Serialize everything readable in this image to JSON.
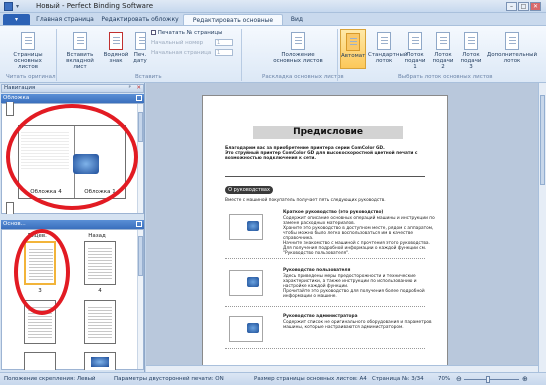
{
  "window": {
    "title": "Новый - Perfect Binding Software",
    "quick_access": "▾",
    "min": "–",
    "max": "□",
    "close": "✕"
  },
  "ribbon_tabs": {
    "file": "▾",
    "tabs": [
      "Главная страница",
      "Редактировать обложку",
      "Редактировать основные листы",
      "Вид"
    ],
    "active_index": 2
  },
  "ribbon": {
    "group_read": {
      "label": "Читать оригинал",
      "btn_pages": "Страницы основных листов"
    },
    "group_insert": {
      "label": "Вставить",
      "btn_insert": "Вставить вкладной лист",
      "btn_watermark": "Водяной знак",
      "btn_print_date": "Печ. дату",
      "chk_print_pages": "Печатать № страницы",
      "start_number_label": "Начальный номер",
      "start_number_value": "1",
      "start_page_label": "Начальная страница",
      "start_page_value": "1"
    },
    "group_layout": {
      "label": "Раскладка основных листов",
      "btn_position": "Положение основных листов"
    },
    "group_tray": {
      "label": "Выбрать лоток основных листов",
      "buttons": [
        "Автомат",
        "Стандартный лоток",
        "Лоток подачи 1",
        "Лоток подачи 2",
        "Лоток подачи 3",
        "Дополнительный лоток"
      ]
    }
  },
  "nav": {
    "title": "Навигация",
    "pin": "ᵖ",
    "close": "✕",
    "cover_section": "Обложка",
    "cover_labels": [
      "Обложка 4",
      "Обложка 1"
    ],
    "main_section": "Основ...",
    "main_labels": [
      "Лицев.",
      "Назад"
    ],
    "page_numbers": [
      "3",
      "4"
    ]
  },
  "document": {
    "heading": "Предисловие",
    "intro": "Благодарим вас за приобретение принтера серии ComColor GD.\nЭто струйный принтер ComColor GD для высокоскоростной цветной печати с возможностью подключения к сети.",
    "about_pill": "О руководствах",
    "about_text": "Вместе с машиной покупатель получает пять следующих руководств.",
    "sections": [
      {
        "title": "Краткое руководство (это руководство)",
        "body": "Содержит описание основных операций машины и инструкции по замене расходных материалов.\nХраните это руководство в доступном месте, рядом с аппаратом, чтобы можно было легко воспользоваться им в качестве справочника.\nНачните знакомство с машиной с прочтения этого руководства.\nДля получения подробной информации о каждой функции см. \"Руководство пользователя\"."
      },
      {
        "title": "Руководство пользователя",
        "body": "Здесь приведены меры предосторожности и технические характеристики, а также инструкции по использованию и настройке каждой функции.\nПрочитайте это руководство для получения более подробной информации о машине."
      },
      {
        "title": "Руководство администратора",
        "body": "Содержит список не оригинального оборудования и параметров машины, которые настраиваются администратором."
      }
    ]
  },
  "status": {
    "binding": "Положение скрепления: Левый",
    "duplex": "Параметры двусторонней печати: ON",
    "size": "Размер страницы основных листов: A4",
    "page": "Страница №: 3/34",
    "zoom": "70%",
    "zoom_out": "⊖",
    "zoom_in": "⊕"
  },
  "colors": {
    "annotation_ring": "#e21b23",
    "file_tab": "#2c62b6"
  }
}
